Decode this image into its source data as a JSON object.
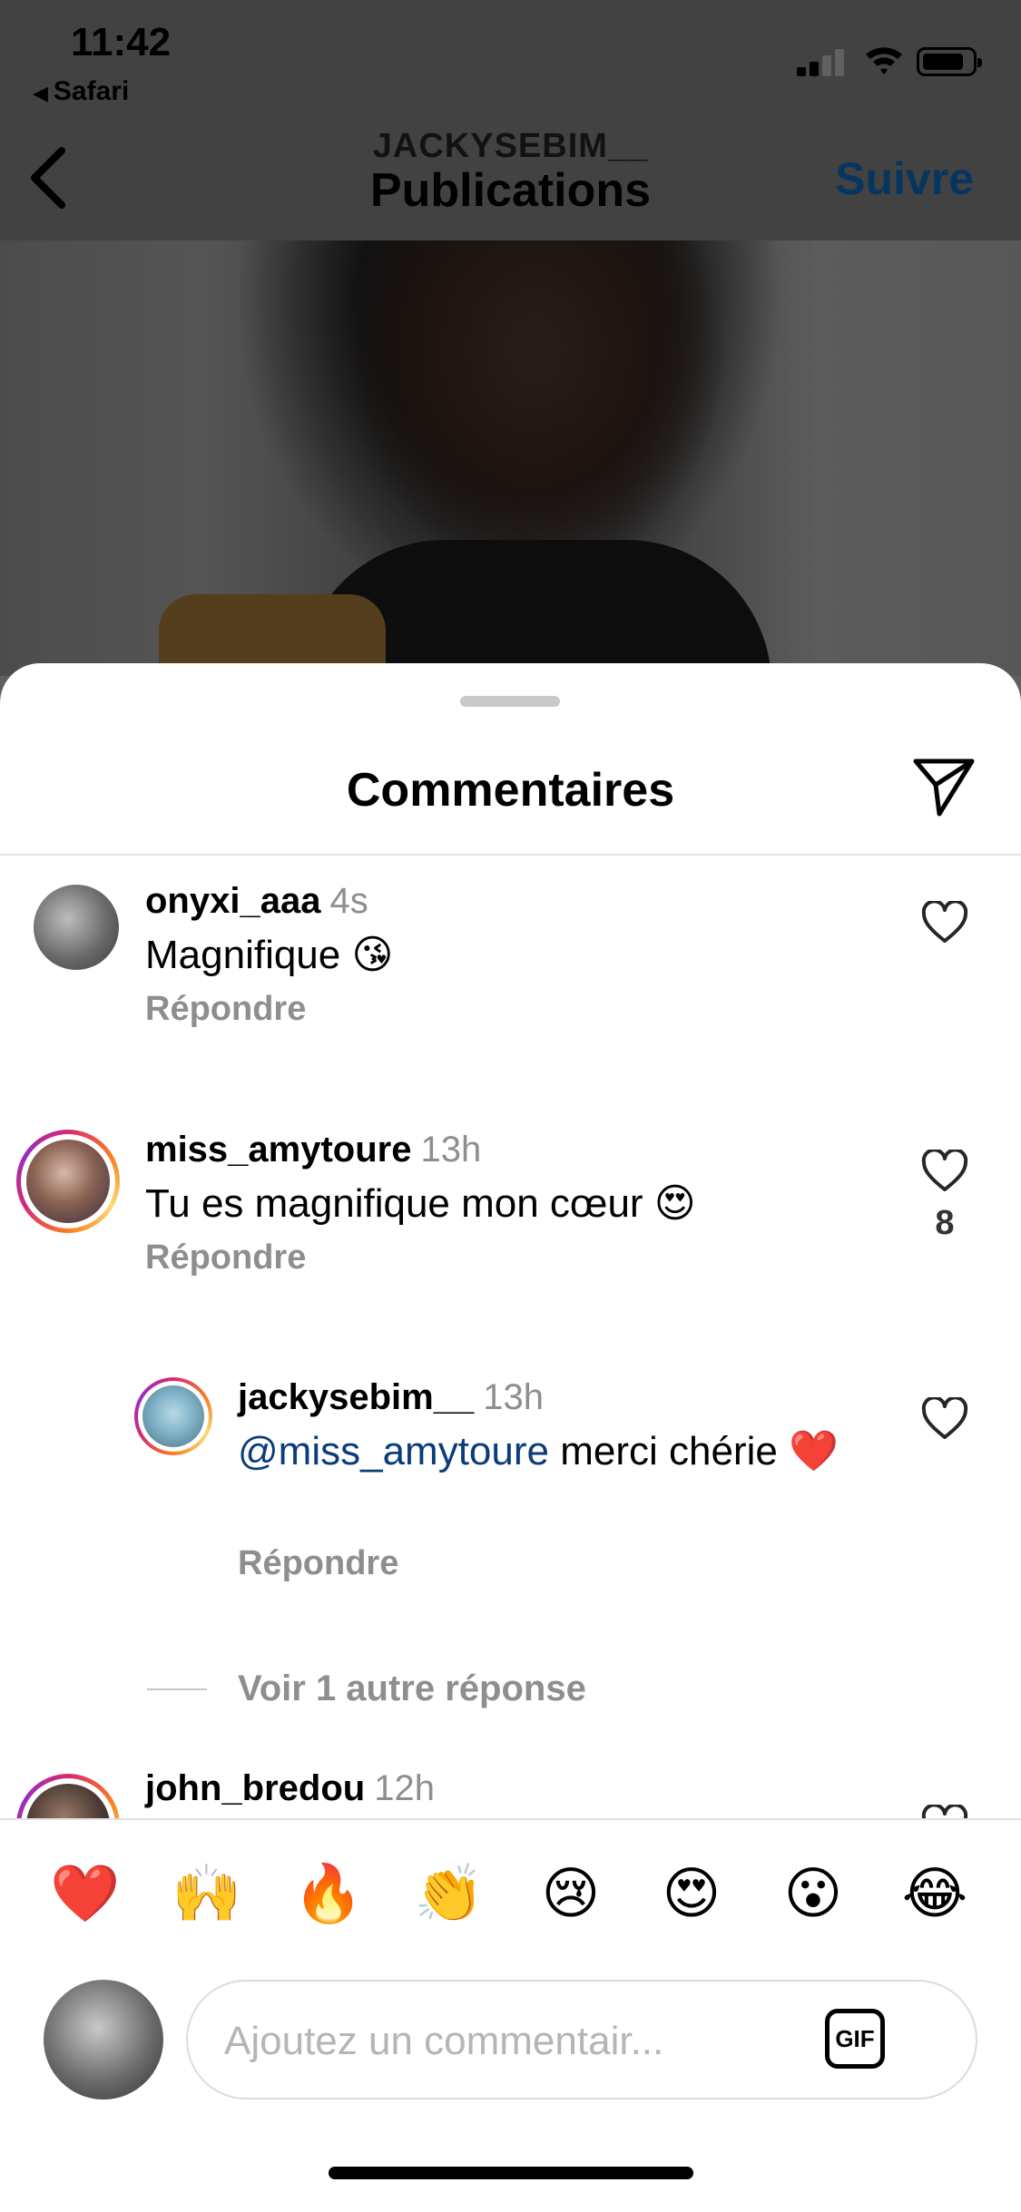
{
  "status_bar": {
    "time": "11:42",
    "back_app": "Safari"
  },
  "nav": {
    "username": "JACKYSEBIM__",
    "title": "Publications",
    "follow_label": "Suivre"
  },
  "sheet": {
    "title": "Commentaires"
  },
  "comments": [
    {
      "user": "onyxi_aaa",
      "time": "4s",
      "text": "Magnifique 😘",
      "reply_label": "Répondre",
      "likes": ""
    },
    {
      "user": "miss_amytoure",
      "time": "13h",
      "text": "Tu es magnifique mon cœur 😍",
      "reply_label": "Répondre",
      "likes": "8"
    },
    {
      "user": "jackysebim__",
      "time": "13h",
      "mention": "@miss_amytoure",
      "text": " merci chérie ❤️",
      "reply_label": "Répondre",
      "likes": ""
    },
    {
      "user": "john_bredou",
      "time": "12h"
    }
  ],
  "more_replies_label": "Voir 1 autre réponse",
  "emoji_bar": [
    "❤️",
    "🙌",
    "🔥",
    "👏",
    "😢",
    "😍",
    "😮",
    "😂"
  ],
  "composer": {
    "placeholder": "Ajoutez un commentair...",
    "value": "",
    "gif_label": "GIF"
  },
  "colors": {
    "accent_blue": "#0a4e8a",
    "mention_blue": "#0a3d7a",
    "secondary_text": "#8e8e8e"
  }
}
